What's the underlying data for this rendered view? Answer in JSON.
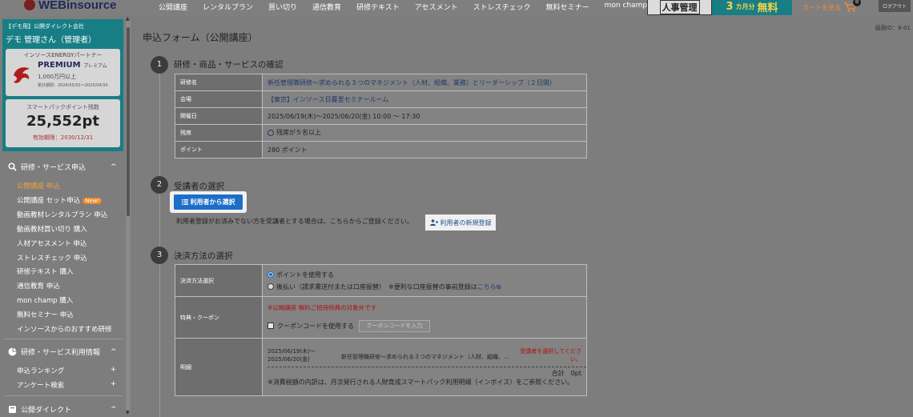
{
  "header": {
    "logo_text": "WEBinsource",
    "nav": [
      "公開講座",
      "レンタルプラン",
      "買い切り",
      "通信教育",
      "研修テキスト",
      "アセスメント",
      "ストレスチェック",
      "無料セミナー",
      "mon champ"
    ],
    "banner_hr": "人事管理",
    "banner_free_months": "3",
    "banner_free_unit": "カ月分",
    "banner_free_text": "無料",
    "cart_label": "カートを見る",
    "cart_count": "0",
    "logout_label": "ログアウト"
  },
  "sidebar": {
    "company": "【デモ用】公開ダイレクト会社",
    "user": "デモ 管理さん（管理者）",
    "partner_label": "インソースENERGYパートナー",
    "rank": "PREMIUM",
    "rank_sub": "プレミアム",
    "amount": "1,000万円以上",
    "period": "累計期間：2024/05/01～2025/04/30",
    "points_label": "スマートパックポイント残数",
    "points_value": "25,552pt",
    "points_expiry": "有効期限：2030/12/31",
    "section1": "研修・サービス申込",
    "items1": [
      "公開講座 申込",
      "公開講座 セット申込",
      "動画教材レンタルプラン 申込",
      "動画教材買い切り 購入",
      "人材アセスメント 申込",
      "ストレスチェック 申込",
      "研修テキスト 購入",
      "通信教育 申込",
      "mon champ 購入",
      "無料セミナー 申込",
      "インソースからのおすすめ研修"
    ],
    "new_badge": "New!",
    "section2": "研修・サービス利用情報",
    "items2": [
      "申込ランキング",
      "アンケート検索"
    ],
    "section3": "公開ダイレクト"
  },
  "main": {
    "screen_id": "画面ID：8-01",
    "title": "申込フォーム（公開講座）",
    "step1": {
      "num": "1",
      "title": "研修・商品・サービスの確認"
    },
    "course_rows": [
      {
        "label": "研修名",
        "value": "新任管理職研修～求められる３つのマネジメント（人材、組織、業務）とリーダーシップ（２日間）"
      },
      {
        "label": "会場",
        "value": "【東京】インソース日暮里セミナールーム"
      },
      {
        "label": "開催日",
        "value": "2025/06/19(木)～2025/06/20(金) 10:00 ～ 17:30"
      },
      {
        "label": "残席",
        "value": "残席が５名以上"
      },
      {
        "label": "ポイント",
        "value": "280 ポイント"
      }
    ],
    "step2": {
      "num": "2",
      "title": "受講者の選択"
    },
    "select_button": "利用者から選択",
    "hint": "利用者登録がお済みでない方を受講者とする場合は、こちらからご登録ください。",
    "new_user_button": "利用者の新規登録",
    "step3": {
      "num": "3",
      "title": "決済方法の選択"
    },
    "payment_label": "決済方法選択",
    "opt_points": "ポイントを使用する",
    "opt_deferred": "後払い（請求書送付または口座振替）",
    "deferred_note": "※便利な口座振替の事前登録は",
    "deferred_link": "こちら",
    "coupon_label": "特典・クーポン",
    "coupon_note": "※公開講座 無料ご招待特典の対象外です",
    "coupon_check": "クーポンコードを使用する",
    "coupon_btn": "クーポンコードを入力",
    "detail_label": "明細",
    "detail_date": "2025/06/19(木)～2025/06/20(金)",
    "detail_name": "新任管理職研修～求められる３つのマネジメント（人材、組織、…",
    "detail_warn": "受講者を選択してください。",
    "total_label": "合計",
    "total_value": "0pt",
    "tax_note": "※消費税額の内訳は、月次発行される人財育成スマートパック利用明細（インボイス）をご参照ください。"
  }
}
